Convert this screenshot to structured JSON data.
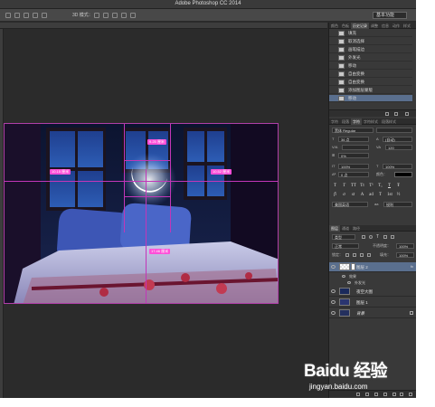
{
  "window": {
    "title": "Adobe Photoshop CC 2014"
  },
  "options_bar": {
    "mode_label": "3D 模式：",
    "workspace": "基本功能"
  },
  "canvas": {
    "measures": {
      "top": "9.25 厘米",
      "left": "10.15 厘米",
      "right": "10.52 厘米",
      "bottom": "17.46 厘米"
    }
  },
  "history_panel": {
    "tabs": [
      "颜色",
      "色板",
      "历史记录",
      "调整",
      "信息",
      "动作",
      "样式"
    ],
    "active_tab": "历史记录",
    "items": [
      {
        "label": "填充"
      },
      {
        "label": "取消选择"
      },
      {
        "label": "画笔描边"
      },
      {
        "label": "外发光"
      },
      {
        "label": "移动"
      },
      {
        "label": "自由变换"
      },
      {
        "label": "自由变换"
      },
      {
        "label": "添加图层蒙版"
      },
      {
        "label": "移动"
      }
    ]
  },
  "character_panel": {
    "tabs": [
      "字符",
      "段落",
      "字符样式",
      "段落样式"
    ],
    "active_tab": "字符",
    "font_family": "黑体",
    "font_style": "Regular",
    "size": "36 点",
    "leading": "(自动)",
    "tracking_label": "VA",
    "tracking": "120",
    "kerning": "0%",
    "scale_v": "100%",
    "scale_h": "100%",
    "baseline": "0 点",
    "color_label": "颜色：",
    "language": "美国英语",
    "aa_label": "aa",
    "aa_mode": "锐利",
    "type_styles": [
      "T",
      "T",
      "TT",
      "Tt",
      "T¹",
      "T₁",
      "T",
      "Ŧ"
    ],
    "opentype": [
      "fi",
      "σ",
      "st",
      "A",
      "ad",
      "T",
      "1st",
      "½"
    ]
  },
  "layers_panel": {
    "tabs": [
      "图层",
      "通道",
      "路径"
    ],
    "active_tab": "图层",
    "filter": "类型",
    "blend_mode": "正常",
    "opacity_label": "不透明度：",
    "opacity": "100%",
    "lock_label": "锁定：",
    "fill_label": "填充：",
    "fill": "100%",
    "layers": [
      {
        "name": "图层 2",
        "active": true,
        "fx": "fx"
      },
      {
        "name": "效果",
        "sub": true
      },
      {
        "name": "外发光",
        "sub": true
      },
      {
        "name": "夜空大图",
        "active": false
      },
      {
        "name": "图层 1",
        "active": false
      },
      {
        "name": "背景",
        "active": false
      }
    ]
  },
  "watermark": {
    "brand": "Baidu 经验",
    "url": "jingyan.baidu.com"
  },
  "colors": {
    "guide": "#c236b8",
    "measure_bg": "#ff4fd8",
    "panel_bg": "#393939",
    "active_row": "#5a6f8e"
  }
}
